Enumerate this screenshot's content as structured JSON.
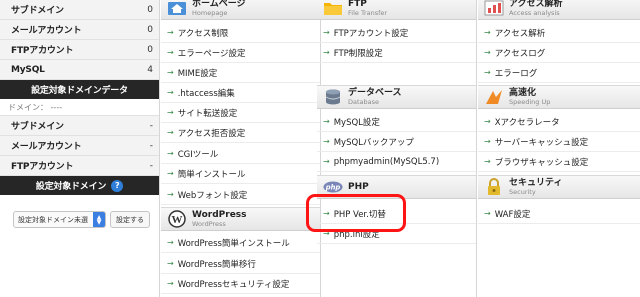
{
  "sidebar": {
    "stats_top": [
      {
        "label": "サブドメイン",
        "value": "0"
      },
      {
        "label": "メールアカウント",
        "value": "0"
      },
      {
        "label": "FTPアカウント",
        "value": "0"
      },
      {
        "label": "MySQL",
        "value": "4"
      }
    ],
    "domain_data_title": "設定対象ドメインデータ",
    "domain_line": "ドメイン： ----",
    "stats_domain": [
      {
        "label": "サブドメイン",
        "value": "-"
      },
      {
        "label": "メールアカウント",
        "value": "-"
      },
      {
        "label": "FTPアカウント",
        "value": "-"
      }
    ],
    "target_domain_title": "設定対象ドメイン",
    "help_icon": "?",
    "domain_select_value": "設定対象ドメイン未選",
    "set_button_label": "設定する"
  },
  "columns": {
    "homepage": {
      "title": "ホームページ",
      "subtitle": "Homepage",
      "icon": "home-icon",
      "items": [
        "アクセス制限",
        "エラーページ設定",
        "MIME設定",
        ".htaccess編集",
        "サイト転送設定",
        "アクセス拒否設定",
        "CGIツール",
        "簡単インストール",
        "Webフォント設定"
      ]
    },
    "wordpress": {
      "title": "WordPress",
      "subtitle": "WordPress",
      "icon": "wordpress-icon",
      "items": [
        "WordPress簡単インストール",
        "WordPress簡単移行",
        "WordPressセキュリティ設定"
      ]
    },
    "ftp": {
      "title": "FTP",
      "subtitle": "File Transfer",
      "icon": "folder-icon",
      "items": [
        "FTPアカウント設定",
        "FTP制限設定"
      ]
    },
    "database": {
      "title": "データベース",
      "subtitle": "Database",
      "icon": "database-icon",
      "items": [
        "MySQL設定",
        "MySQLバックアップ",
        "phpmyadmin(MySQL5.7)"
      ]
    },
    "php": {
      "title": "PHP",
      "subtitle": "",
      "icon": "php-icon",
      "items": [
        "PHP Ver.切替",
        "php.ini設定"
      ]
    },
    "access": {
      "title": "アクセス解析",
      "subtitle": "Access analysis",
      "icon": "chart-icon",
      "items": [
        "アクセス解析",
        "アクセスログ",
        "エラーログ"
      ]
    },
    "speed": {
      "title": "高速化",
      "subtitle": "Speeding Up",
      "icon": "speed-icon",
      "items": [
        "Xアクセラレータ",
        "サーバーキャッシュ設定",
        "ブラウザキャッシュ設定"
      ]
    },
    "security": {
      "title": "セキュリティ",
      "subtitle": "Security",
      "icon": "lock-icon",
      "items": [
        "WAF設定"
      ]
    }
  },
  "colors": {
    "highlight": "#ff1414",
    "dark_bar": "#262626",
    "arrow": "#3a8a4a",
    "accent_blue": "#2f7fd9"
  }
}
